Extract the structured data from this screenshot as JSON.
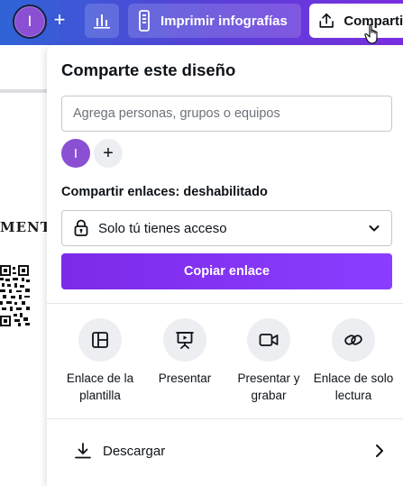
{
  "topbar": {
    "avatar_initial": "I",
    "add_label": "+",
    "print_label": "Imprimir infografías",
    "share_label": "Compartir"
  },
  "canvas": {
    "fragment_text": "MENT"
  },
  "share_panel": {
    "title": "Comparte este diseño",
    "people_placeholder": "Agrega personas, grupos o equipos",
    "people_value": "",
    "owner_initial": "I",
    "add_person_label": "+",
    "links_heading": "Compartir enlaces: deshabilitado",
    "access_value": "Solo tú tienes acceso",
    "copy_link_label": "Copiar enlace",
    "options": [
      {
        "icon": "template-icon",
        "label": "Enlace de la plantilla"
      },
      {
        "icon": "present-icon",
        "label": "Presentar"
      },
      {
        "icon": "video-camera-icon",
        "label": "Presentar y grabar"
      },
      {
        "icon": "link-icon",
        "label": "Enlace de solo lectura"
      }
    ],
    "download_label": "Descargar"
  },
  "colors": {
    "topbar_start": "#2f63d6",
    "topbar_end": "#7a2ee0",
    "accent_purple": "#8b3dff",
    "avatar_purple": "#8a4fd3"
  }
}
